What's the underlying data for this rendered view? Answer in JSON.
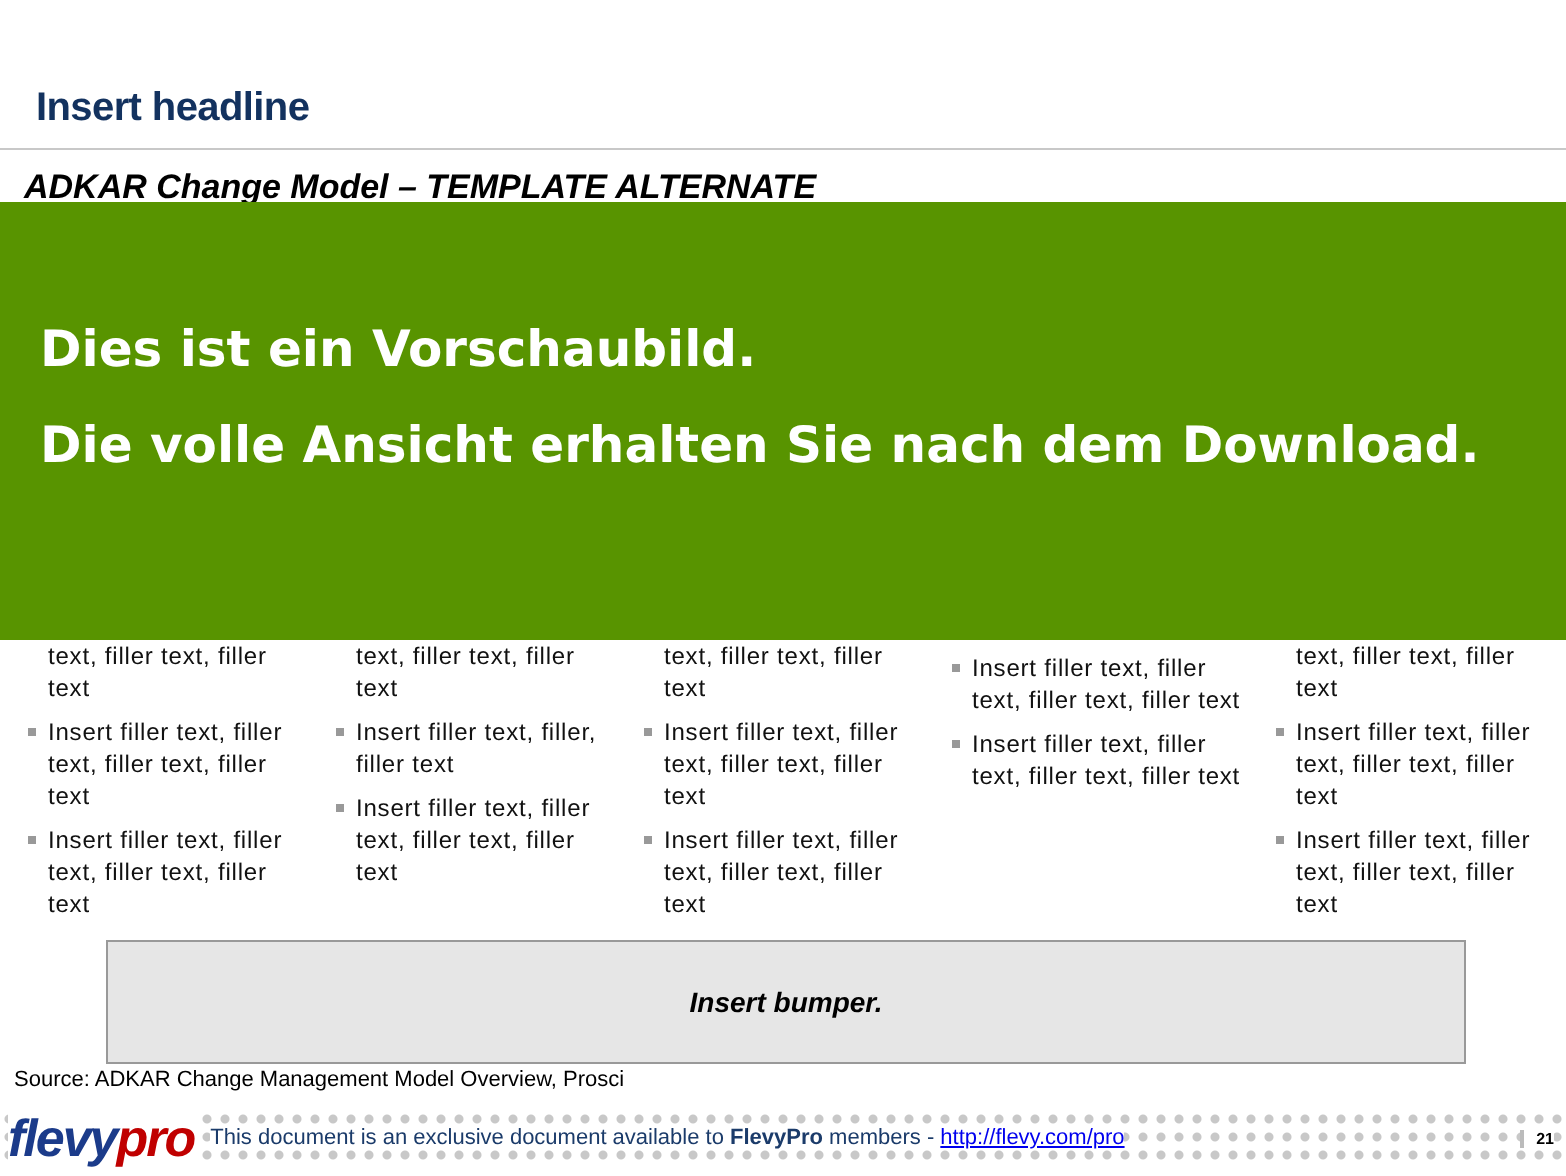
{
  "headline": "Insert headline",
  "subtitle": "ADKAR Change Model – TEMPLATE ALTERNATE",
  "preview_banner": {
    "lines": [
      "Dies ist ein Vorschaubild.",
      "Die volle Ansicht erhalten Sie nach dem Download."
    ]
  },
  "columns": [
    {
      "items": [
        {
          "kind": "fragment",
          "text": "text, filler text, filler text"
        },
        {
          "kind": "bullet",
          "text": "Insert filler text, filler text, filler text, filler text"
        },
        {
          "kind": "bullet",
          "text": "Insert filler text, filler text, filler text, filler text"
        }
      ]
    },
    {
      "items": [
        {
          "kind": "fragment",
          "text": "text, filler text, filler text"
        },
        {
          "kind": "bullet",
          "text": "Insert filler text, filler, filler text"
        },
        {
          "kind": "bullet",
          "text": "Insert filler text, filler text, filler text, filler text"
        }
      ]
    },
    {
      "items": [
        {
          "kind": "fragment",
          "text": "text, filler text, filler text"
        },
        {
          "kind": "bullet",
          "text": "Insert filler text, filler text, filler text, filler text"
        },
        {
          "kind": "bullet",
          "text": "Insert filler text, filler text, filler text, filler text"
        }
      ]
    },
    {
      "items": [
        {
          "kind": "bullet",
          "text": "Insert filler text, filler text, filler text, filler text"
        },
        {
          "kind": "bullet",
          "text": "Insert filler text, filler text, filler text, filler text"
        }
      ]
    },
    {
      "items": [
        {
          "kind": "fragment",
          "text": "text, filler text, filler text"
        },
        {
          "kind": "bullet",
          "text": "Insert filler text, filler text, filler text, filler text"
        },
        {
          "kind": "bullet",
          "text": "Insert filler text, filler text, filler text, filler text"
        }
      ]
    }
  ],
  "bumper": "Insert bumper.",
  "source": "Source: ADKAR Change Management Model Overview, Prosci",
  "footer": {
    "logo_main": "flevy",
    "logo_accent": "pro",
    "notice": "This document is an exclusive document available to **FlevyPro** members - ",
    "link": "http://flevy.com/pro",
    "page": "21"
  }
}
